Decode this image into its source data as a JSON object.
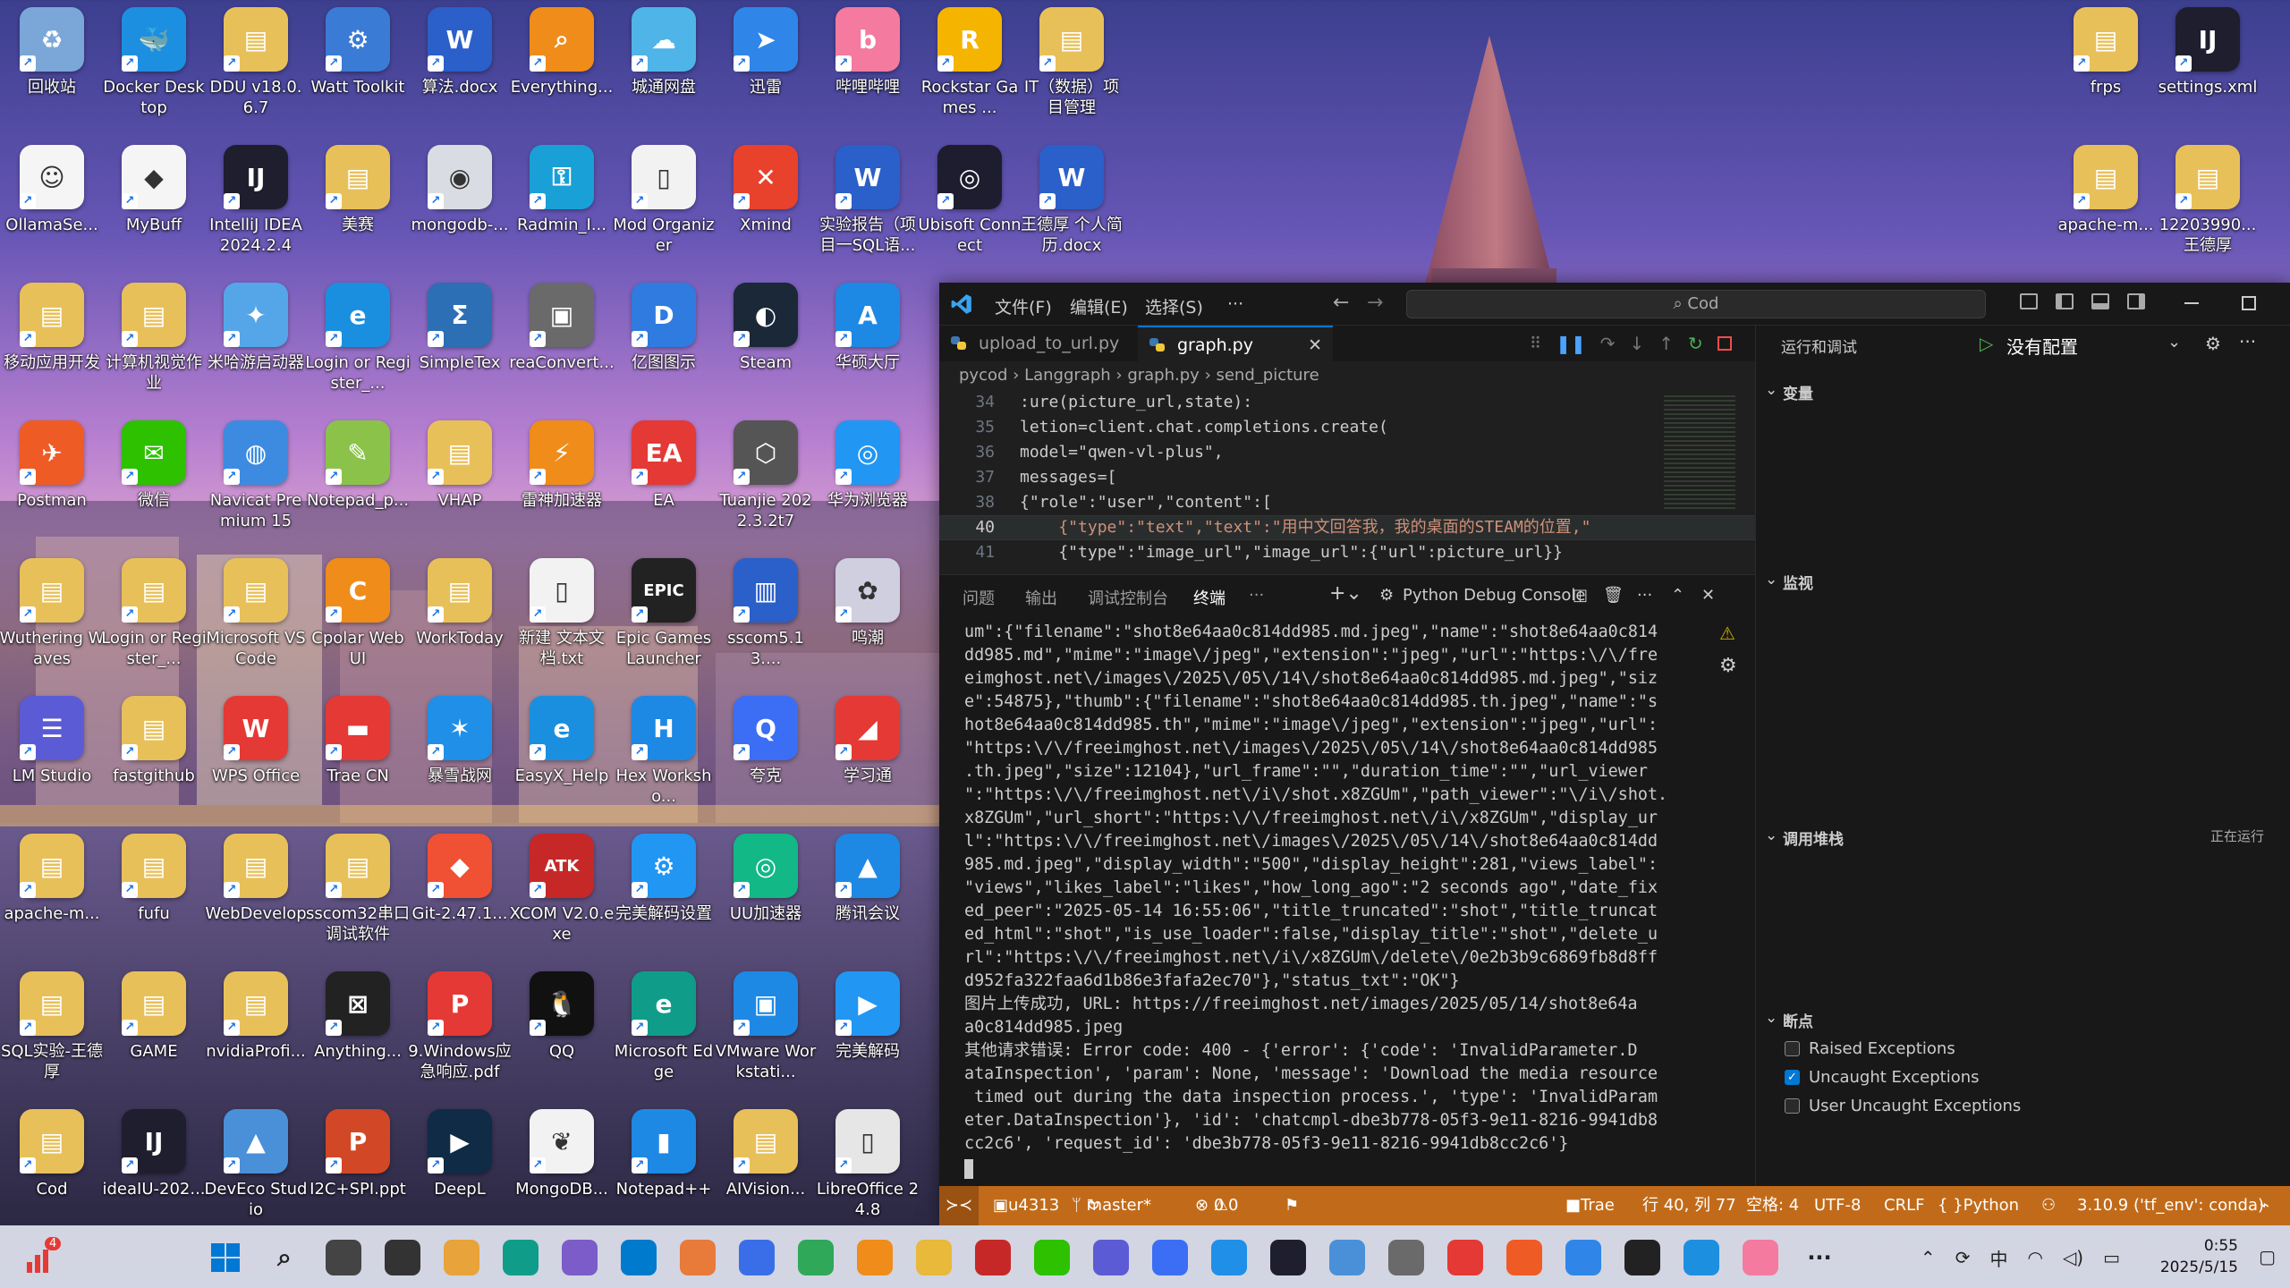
{
  "desktop": {
    "icons": [
      {
        "label": "回收站",
        "color": "#7aa7d8",
        "glyph": "♻"
      },
      {
        "label": "Docker Desktop",
        "color": "#1d8fe0",
        "glyph": "🐳"
      },
      {
        "label": "DDU v18.0.6.7",
        "color": "#e8c05a",
        "glyph": "▤"
      },
      {
        "label": "Watt Toolkit",
        "color": "#3a7bd5",
        "glyph": "⚙"
      },
      {
        "label": "算法.docx",
        "color": "#2b5fc9",
        "glyph": "W"
      },
      {
        "label": "Everything...",
        "color": "#f08c1a",
        "glyph": "⌕"
      },
      {
        "label": "城通网盘",
        "color": "#4fb4e8",
        "glyph": "☁"
      },
      {
        "label": "迅雷",
        "color": "#2f86e8",
        "glyph": "➤"
      },
      {
        "label": "哔哩哔哩",
        "color": "#f47aa0",
        "glyph": "b"
      },
      {
        "label": "Rockstar Games ...",
        "color": "#f4b400",
        "glyph": "R"
      },
      {
        "label": "IT（数据）项目管理",
        "color": "#e8c05a",
        "glyph": "▤"
      },
      {
        "label": "frps",
        "color": "#e8c05a",
        "glyph": "▤"
      },
      {
        "label": "settings.xml",
        "color": "#1e1e2e",
        "glyph": "IJ"
      },
      {
        "label": "OllamaSe...",
        "color": "#f5f5f5",
        "glyph": "☺"
      },
      {
        "label": "MyBuff",
        "color": "#f5f5f5",
        "glyph": "◆"
      },
      {
        "label": "IntelliJ IDEA 2024.2.4",
        "color": "#1e1e2e",
        "glyph": "IJ"
      },
      {
        "label": "美赛",
        "color": "#e8c05a",
        "glyph": "▤"
      },
      {
        "label": "mongodb-...",
        "color": "#d9dde3",
        "glyph": "◉"
      },
      {
        "label": "Radmin_I...",
        "color": "#19a0d6",
        "glyph": "⚿"
      },
      {
        "label": "Mod Organizer",
        "color": "#f2f2f2",
        "glyph": "▯"
      },
      {
        "label": "Xmind",
        "color": "#e8412c",
        "glyph": "✕"
      },
      {
        "label": "实验报告（项目一SQL语...",
        "color": "#2b5fc9",
        "glyph": "W"
      },
      {
        "label": "Ubisoft Connect",
        "color": "#1d1d2f",
        "glyph": "◎"
      },
      {
        "label": "王德厚 个人简历.docx",
        "color": "#2b5fc9",
        "glyph": "W"
      },
      {
        "label": "apache-m...",
        "color": "#e8c05a",
        "glyph": "▤"
      },
      {
        "label": "12203990...王德厚",
        "color": "#e8c05a",
        "glyph": "▤"
      },
      {
        "label": "移动应用开发",
        "color": "#e8c05a",
        "glyph": "▤"
      },
      {
        "label": "计算机视觉作业",
        "color": "#e8c05a",
        "glyph": "▤"
      },
      {
        "label": "米哈游启动器",
        "color": "#55a6e8",
        "glyph": "✦"
      },
      {
        "label": "Login or Register_...",
        "color": "#1a8fe0",
        "glyph": "e"
      },
      {
        "label": "SimpleTex",
        "color": "#2c6fb5",
        "glyph": "Σ"
      },
      {
        "label": "reaConvert...",
        "color": "#6a6a6a",
        "glyph": "▣"
      },
      {
        "label": "亿图图示",
        "color": "#2f7be0",
        "glyph": "D"
      },
      {
        "label": "Steam",
        "color": "#1b2838",
        "glyph": "◐"
      },
      {
        "label": "华硕大厅",
        "color": "#1e88e5",
        "glyph": "A"
      },
      {
        "label": "Postman",
        "color": "#ef5b25",
        "glyph": "✈"
      },
      {
        "label": "微信",
        "color": "#2dc100",
        "glyph": "✉"
      },
      {
        "label": "Navicat Premium 15",
        "color": "#3d8be0",
        "glyph": "◍"
      },
      {
        "label": "Notepad_p...",
        "color": "#8bc34a",
        "glyph": "✎"
      },
      {
        "label": "VHAP",
        "color": "#e8c05a",
        "glyph": "▤"
      },
      {
        "label": "雷神加速器",
        "color": "#f08c1a",
        "glyph": "⚡"
      },
      {
        "label": "EA",
        "color": "#e53935",
        "glyph": "EA"
      },
      {
        "label": "Tuanjie 2022.3.2t7",
        "color": "#555",
        "glyph": "⬡"
      },
      {
        "label": "华为浏览器",
        "color": "#2196f3",
        "glyph": "◎"
      },
      {
        "label": "Wuthering Waves",
        "color": "#e8c05a",
        "glyph": "▤"
      },
      {
        "label": "Login or Register_...",
        "color": "#e8c05a",
        "glyph": "▤"
      },
      {
        "label": "Microsoft VS Code",
        "color": "#e8c05a",
        "glyph": "▤"
      },
      {
        "label": "Cpolar Web UI",
        "color": "#f08c1a",
        "glyph": "C"
      },
      {
        "label": "WorkToday",
        "color": "#e8c05a",
        "glyph": "▤"
      },
      {
        "label": "新建 文本文档.txt",
        "color": "#f2f2f2",
        "glyph": "▯"
      },
      {
        "label": "Epic Games Launcher",
        "color": "#222",
        "glyph": "EPIC"
      },
      {
        "label": "sscom5.13....",
        "color": "#2b5fc9",
        "glyph": "▥"
      },
      {
        "label": "鸣潮",
        "color": "#cfcfe0",
        "glyph": "✿"
      },
      {
        "label": "LM Studio",
        "color": "#5b5bd6",
        "glyph": "☰"
      },
      {
        "label": "fastgithub",
        "color": "#e8c05a",
        "glyph": "▤"
      },
      {
        "label": "WPS Office",
        "color": "#e53935",
        "glyph": "W"
      },
      {
        "label": "Trae CN",
        "color": "#e53935",
        "glyph": "▬"
      },
      {
        "label": "暴雪战网",
        "color": "#1f8fe8",
        "glyph": "✶"
      },
      {
        "label": "EasyX_Help",
        "color": "#1a8fe0",
        "glyph": "e"
      },
      {
        "label": "Hex Worksho...",
        "color": "#1e88e5",
        "glyph": "H"
      },
      {
        "label": "夸克",
        "color": "#3b6ef5",
        "glyph": "Q"
      },
      {
        "label": "学习通",
        "color": "#e53935",
        "glyph": "◢"
      },
      {
        "label": "apache-m...",
        "color": "#e8c05a",
        "glyph": "▤"
      },
      {
        "label": "fufu",
        "color": "#e8c05a",
        "glyph": "▤"
      },
      {
        "label": "WebDevelop",
        "color": "#e8c05a",
        "glyph": "▤"
      },
      {
        "label": "sscom32串口调试软件",
        "color": "#e8c05a",
        "glyph": "▤"
      },
      {
        "label": "Git-2.47.1...",
        "color": "#f05033",
        "glyph": "◆"
      },
      {
        "label": "XCOM V2.0.exe",
        "color": "#c62828",
        "glyph": "ATK"
      },
      {
        "label": "完美解码设置",
        "color": "#2196f3",
        "glyph": "⚙"
      },
      {
        "label": "UU加速器",
        "color": "#12b886",
        "glyph": "◎"
      },
      {
        "label": "腾讯会议",
        "color": "#1e88e5",
        "glyph": "▲"
      },
      {
        "label": "SQL实验-王德厚",
        "color": "#e8c05a",
        "glyph": "▤"
      },
      {
        "label": "GAME",
        "color": "#e8c05a",
        "glyph": "▤"
      },
      {
        "label": "nvidiaProfi...",
        "color": "#e8c05a",
        "glyph": "▤"
      },
      {
        "label": "Anything...",
        "color": "#222",
        "glyph": "⊠"
      },
      {
        "label": "9.Windows应急响应.pdf",
        "color": "#e53935",
        "glyph": "P"
      },
      {
        "label": "QQ",
        "color": "#111",
        "glyph": "🐧"
      },
      {
        "label": "Microsoft Edge",
        "color": "#0f9d8a",
        "glyph": "e"
      },
      {
        "label": "VMware Workstati...",
        "color": "#1e88e5",
        "glyph": "▣"
      },
      {
        "label": "完美解码",
        "color": "#2196f3",
        "glyph": "▶"
      },
      {
        "label": "Cod",
        "color": "#e8c05a",
        "glyph": "▤"
      },
      {
        "label": "ideaIU-202...",
        "color": "#1e1e2e",
        "glyph": "IJ"
      },
      {
        "label": "DevEco Studio",
        "color": "#4a90d9",
        "glyph": "▲"
      },
      {
        "label": "I2C+SPI.ppt",
        "color": "#d24726",
        "glyph": "P"
      },
      {
        "label": "DeepL",
        "color": "#0f2b46",
        "glyph": "▶"
      },
      {
        "label": "MongoDB...",
        "color": "#f2f2f2",
        "glyph": "❦"
      },
      {
        "label": "Notepad++",
        "color": "#1e88e5",
        "glyph": "▮"
      },
      {
        "label": "AIVision...",
        "color": "#e8c05a",
        "glyph": "▤"
      },
      {
        "label": "LibreOffice 24.8",
        "color": "#e6e6e6",
        "glyph": "▯"
      }
    ]
  },
  "taskbar": {
    "badge": "4",
    "tray": {
      "ime": "中",
      "time": "0:55",
      "date": "2025/5/15"
    }
  },
  "vscode": {
    "menu": [
      "文件(F)",
      "编辑(E)",
      "选择(S)",
      "···"
    ],
    "command_center": "Cod",
    "tabs": [
      {
        "label": "upload_to_url.py"
      },
      {
        "label": "graph.py",
        "active": true
      }
    ],
    "breadcrumb": {
      "b1": "pycod",
      "b2": "Langgraph",
      "b3": "graph.py",
      "b4": "send_picture"
    },
    "code_lines": [
      {
        "n": "34",
        "t": ":ure(picture_url,state):"
      },
      {
        "n": "35",
        "t": "letion=client.chat.completions.create("
      },
      {
        "n": "36",
        "t": "model=\"qwen-vl-plus\","
      },
      {
        "n": "37",
        "t": "messages=["
      },
      {
        "n": "38",
        "t": "{\"role\":\"user\",\"content\":["
      },
      {
        "n": "40",
        "t": "    {\"type\":\"text\",\"text\":\"用中文回答我，我的桌面的STEAM的位置,\""
      },
      {
        "n": "41",
        "t": "    {\"type\":\"image_url\",\"image_url\":{\"url\":picture_url}}"
      }
    ],
    "panel_tabs": [
      "问题",
      "输出",
      "调试控制台",
      "终端",
      "···"
    ],
    "panel_right": "Python Debug Console",
    "terminal": [
      "um\":{\"filename\":\"shot8e64aa0c814dd985.md.jpeg\",\"name\":\"shot8e64aa0c814",
      "dd985.md\",\"mime\":\"image\\/jpeg\",\"extension\":\"jpeg\",\"url\":\"https:\\/\\/fre",
      "eimghost.net\\/images\\/2025\\/05\\/14\\/shot8e64aa0c814dd985.md.jpeg\",\"siz",
      "e\":54875},\"thumb\":{\"filename\":\"shot8e64aa0c814dd985.th.jpeg\",\"name\":\"s",
      "hot8e64aa0c814dd985.th\",\"mime\":\"image\\/jpeg\",\"extension\":\"jpeg\",\"url\":",
      "\"https:\\/\\/freeimghost.net\\/images\\/2025\\/05\\/14\\/shot8e64aa0c814dd985",
      ".th.jpeg\",\"size\":12104},\"url_frame\":\"\",\"duration_time\":\"\",\"url_viewer",
      "\":\"https:\\/\\/freeimghost.net\\/i\\/shot.x8ZGUm\",\"path_viewer\":\"\\/i\\/shot.",
      "x8ZGUm\",\"url_short\":\"https:\\/\\/freeimghost.net\\/i\\/x8ZGUm\",\"display_ur",
      "l\":\"https:\\/\\/freeimghost.net\\/images\\/2025\\/05\\/14\\/shot8e64aa0c814dd",
      "985.md.jpeg\",\"display_width\":\"500\",\"display_height\":281,\"views_label\":",
      "\"views\",\"likes_label\":\"likes\",\"how_long_ago\":\"2 seconds ago\",\"date_fix",
      "ed_peer\":\"2025-05-14 16:55:06\",\"title_truncated\":\"shot\",\"title_truncat",
      "ed_html\":\"shot\",\"is_use_loader\":false,\"display_title\":\"shot\",\"delete_u",
      "rl\":\"https:\\/\\/freeimghost.net\\/i\\/x8ZGUm\\/delete\\/0e2b3b9c6869fb8d8ff",
      "d952fa322faa6d1b86e3fafa2ec70\"},\"status_txt\":\"OK\"}",
      "图片上传成功, URL: https://freeimghost.net/images/2025/05/14/shot8e64a",
      "a0c814dd985.jpeg",
      "其他请求错误: Error code: 400 - {'error': {'code': 'InvalidParameter.D",
      "ataInspection', 'param': None, 'message': 'Download the media resource",
      " timed out during the data inspection process.', 'type': 'InvalidParam",
      "eter.DataInspection'}, 'id': 'chatcmpl-dbe3b778-05f3-9e11-8216-9941db8",
      "cc2c6', 'request_id': 'dbe3b778-05f3-9e11-8216-9941db8cc2c6'}"
    ],
    "debug": {
      "header": "运行和调试",
      "config": "没有配置",
      "sections": {
        "vars": "变量",
        "watch": "监视",
        "stack": "调用堆栈",
        "stack_status": "正在运行",
        "breakpoints": "断点"
      },
      "breakpoints": [
        {
          "label": "Raised Exceptions",
          "checked": false
        },
        {
          "label": "Uncaught Exceptions",
          "checked": true
        },
        {
          "label": "User Uncaught Exceptions",
          "checked": false
        }
      ]
    },
    "status": {
      "remote": "u4313",
      "branch": "master*",
      "errors": "0",
      "warnings": "0",
      "trae": "Trae",
      "position": "行 40, 列 77",
      "spaces": "空格: 4",
      "encoding": "UTF-8",
      "eol": "CRLF",
      "lang": "Python",
      "interpreter": "3.10.9 ('tf_env': conda)"
    }
  }
}
